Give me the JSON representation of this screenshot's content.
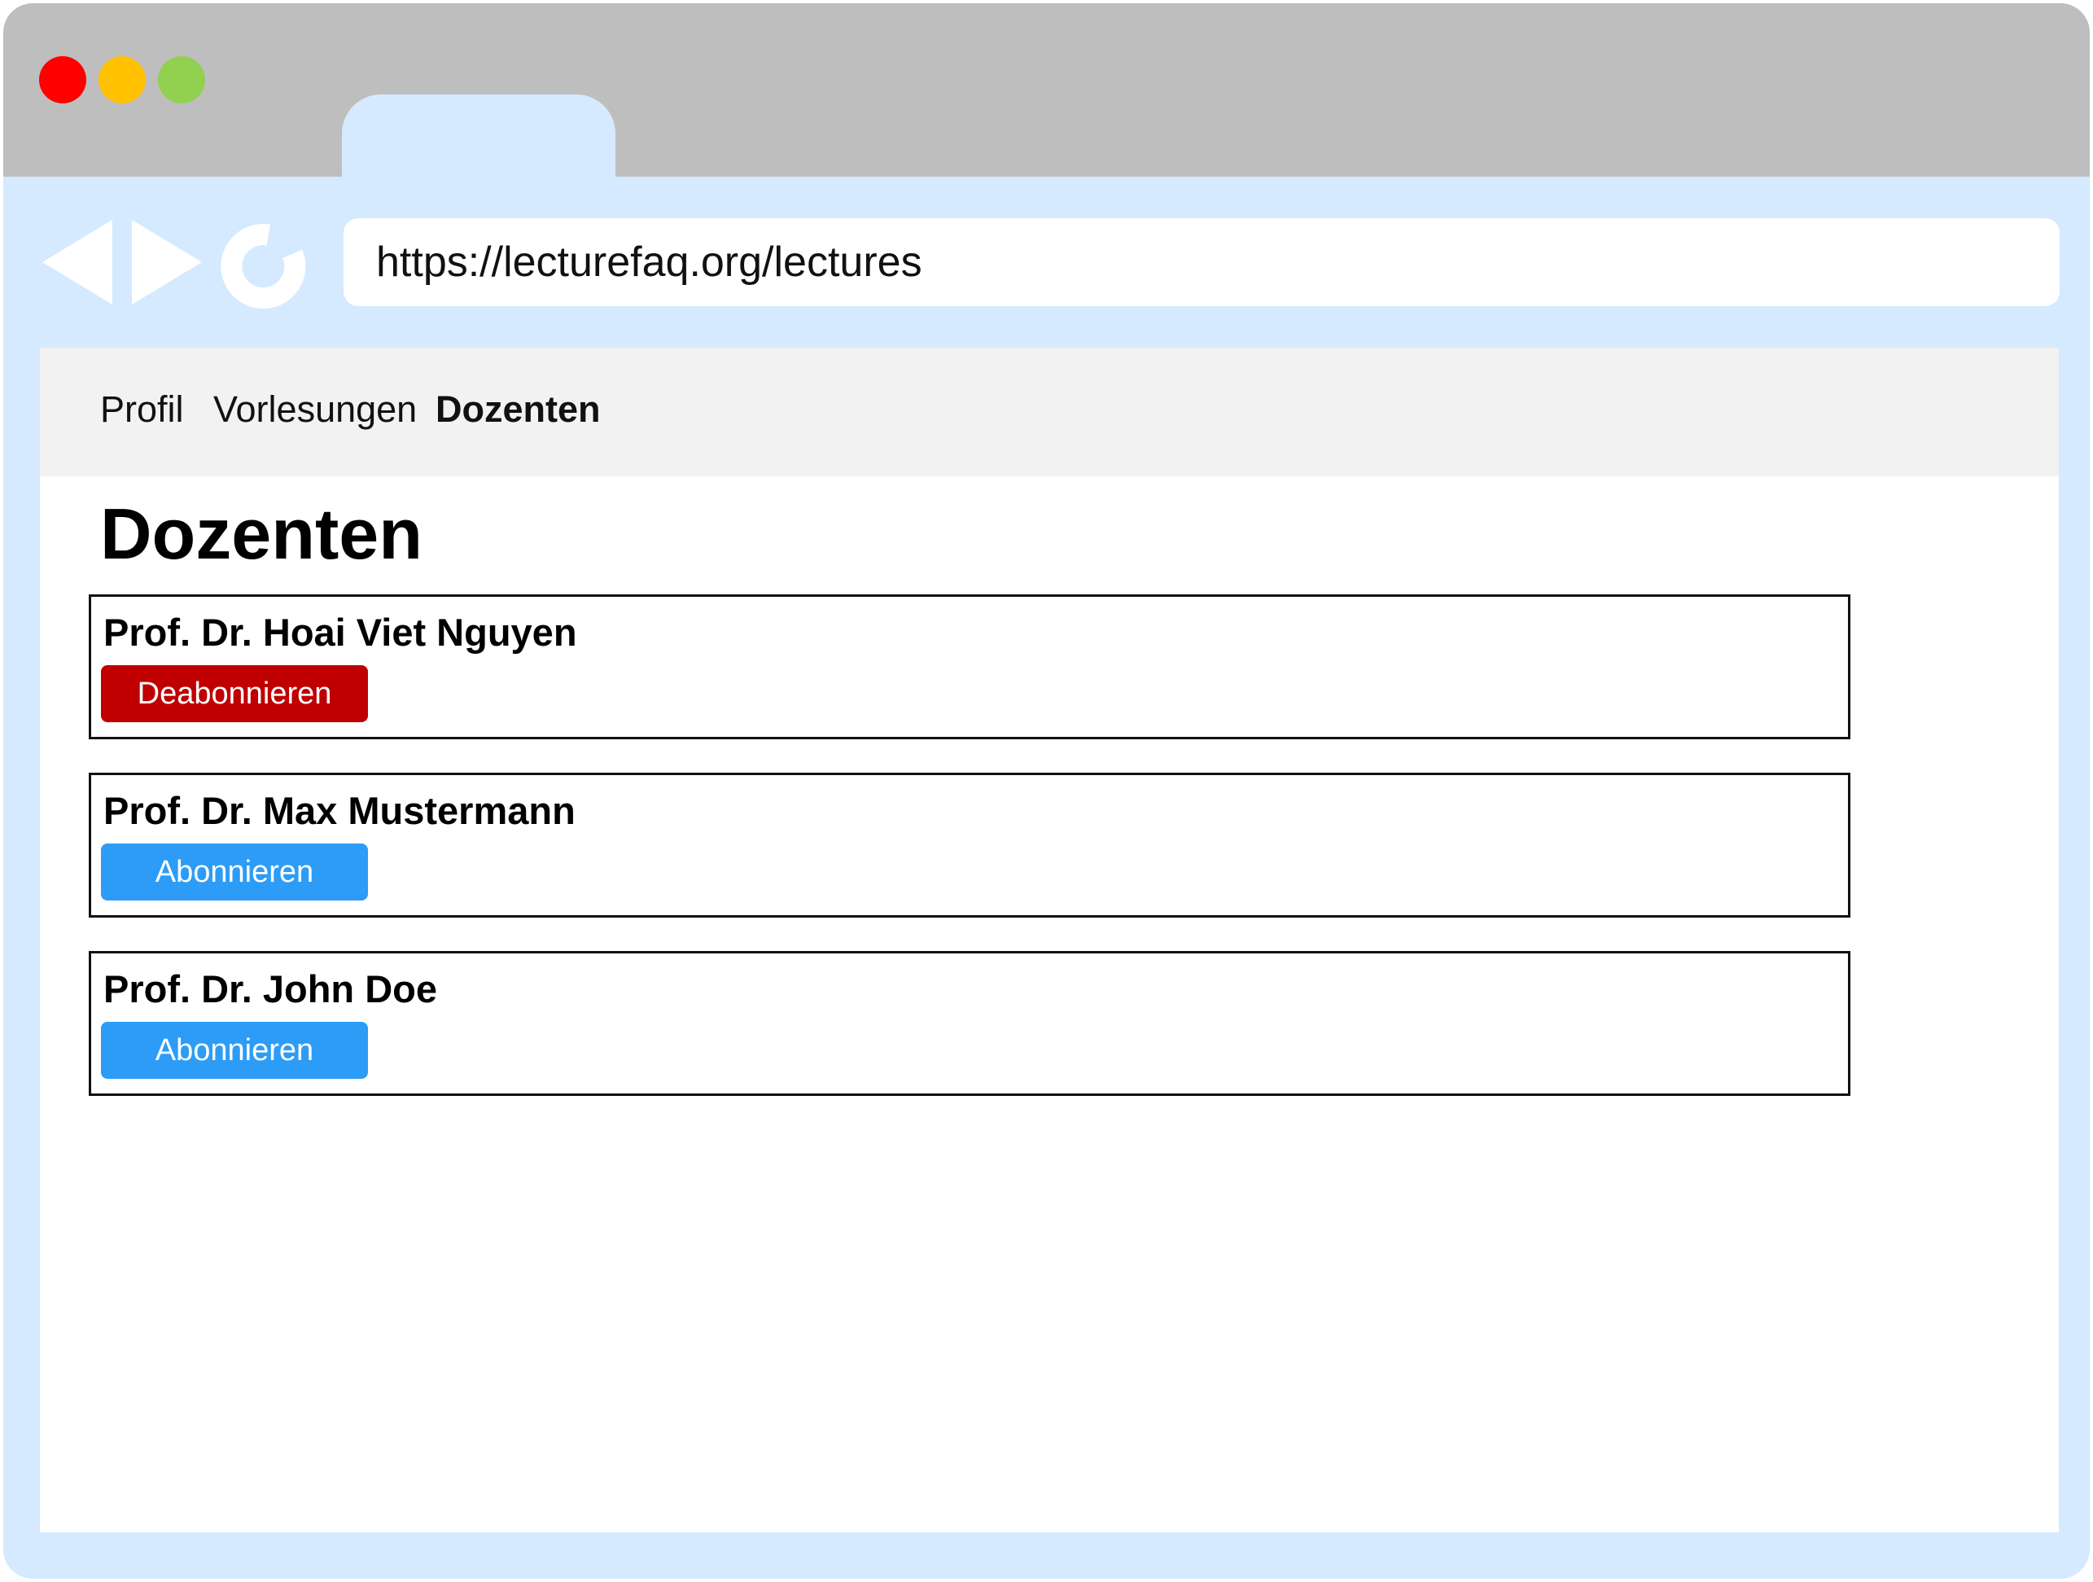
{
  "window": {
    "traffic_lights": {
      "close_color": "#ff0000",
      "minimize_color": "#ffc000",
      "zoom_color": "#92d050"
    },
    "chrome_color": "#d5eaff",
    "titlebar_color": "#bebebe"
  },
  "toolbar": {
    "back_icon": "back-arrow-icon",
    "forward_icon": "forward-arrow-icon",
    "reload_icon": "reload-icon",
    "url": "https://lecturefaq.org/lectures"
  },
  "nav": {
    "items": [
      {
        "label": "Profil",
        "active": false
      },
      {
        "label": "Vorlesungen",
        "active": false
      },
      {
        "label": "Dozenten",
        "active": true
      }
    ]
  },
  "page": {
    "title": "Dozenten"
  },
  "lecturers": [
    {
      "name": "Prof. Dr. Hoai Viet Nguyen",
      "button_label": "Deabonnieren",
      "subscribed": true,
      "button_color": "#c00000"
    },
    {
      "name": "Prof. Dr. Max Mustermann",
      "button_label": "Abonnieren",
      "subscribed": false,
      "button_color": "#2c9cf7"
    },
    {
      "name": "Prof. Dr. John Doe",
      "button_label": "Abonnieren",
      "subscribed": false,
      "button_color": "#2c9cf7"
    }
  ]
}
